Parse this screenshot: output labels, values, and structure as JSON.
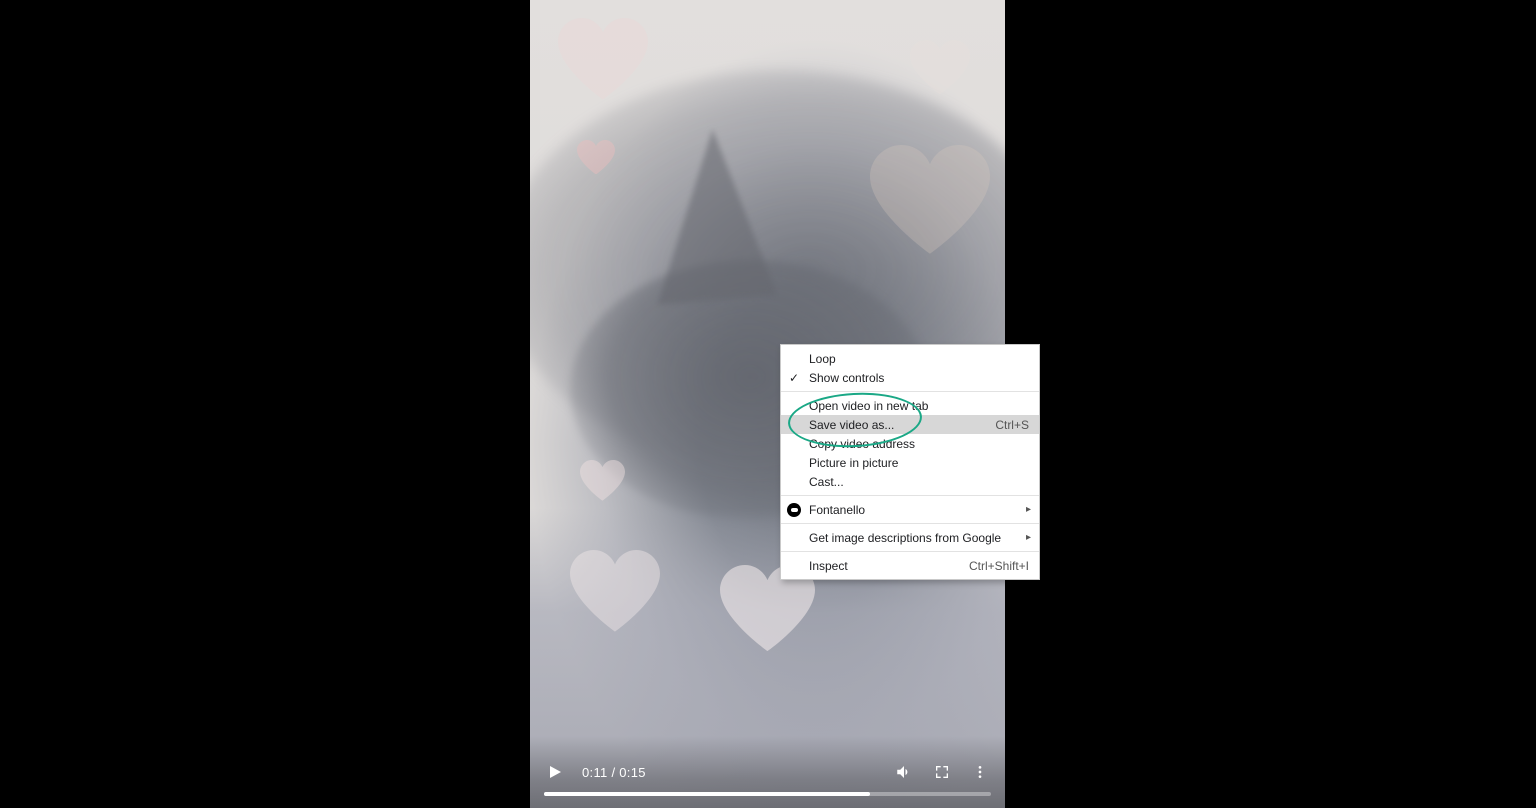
{
  "player": {
    "current_time": "0:11",
    "duration": "0:15",
    "time_display": "0:11 / 0:15",
    "progress_percent": 73
  },
  "context_menu": {
    "items": [
      {
        "label": "Loop",
        "checked": false,
        "highlighted": false
      },
      {
        "label": "Show controls",
        "checked": true,
        "highlighted": false
      }
    ],
    "group2": [
      {
        "label": "Open video in new tab",
        "highlighted": false
      },
      {
        "label": "Save video as...",
        "shortcut": "Ctrl+S",
        "highlighted": true
      },
      {
        "label": "Copy video address",
        "highlighted": false
      },
      {
        "label": "Picture in picture",
        "highlighted": false
      },
      {
        "label": "Cast...",
        "highlighted": false
      }
    ],
    "group3": [
      {
        "label": "Fontanello",
        "submenu": true,
        "icon": true
      }
    ],
    "group4": [
      {
        "label": "Get image descriptions from Google",
        "submenu": true
      }
    ],
    "group5": [
      {
        "label": "Inspect",
        "shortcut": "Ctrl+Shift+I"
      }
    ]
  },
  "annotation": {
    "color": "#1aa886"
  }
}
